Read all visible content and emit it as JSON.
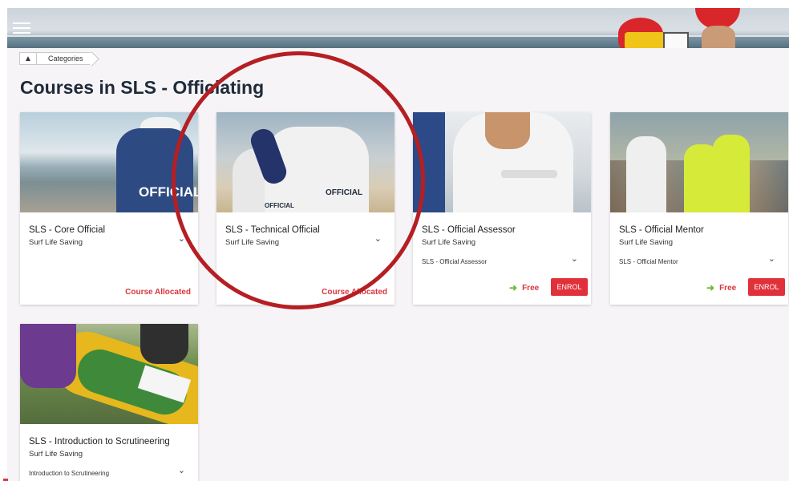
{
  "breadcrumb": {
    "home_icon": "home-icon",
    "items": [
      "Categories"
    ]
  },
  "page_title": "Courses in SLS - Officiating",
  "courses": [
    {
      "title": "SLS - Core Official",
      "org": "Surf Life Saving",
      "status": "Course Allocated"
    },
    {
      "title": "SLS - Technical Official",
      "org": "Surf Life Saving",
      "status": "Course Allocated"
    },
    {
      "title": "SLS - Official Assessor",
      "org": "Surf Life Saving",
      "subtitle": "SLS - Official Assessor",
      "price": "Free",
      "action": "ENROL"
    },
    {
      "title": "SLS - Official Mentor",
      "org": "Surf Life Saving",
      "subtitle": "SLS - Official Mentor",
      "price": "Free",
      "action": "ENROL"
    },
    {
      "title": "SLS - Introduction to Scrutineering",
      "org": "Surf Life Saving",
      "subtitle": "Introduction to Scrutineering"
    }
  ],
  "image_text": {
    "official": "OFFICIAL",
    "official_small": "OFFICIAL"
  },
  "colors": {
    "accent_red": "#e0313a",
    "free_arrow": "#6bbd3a",
    "annotation": "#b51f24"
  },
  "icons": {
    "menu": "hamburger-menu-icon",
    "expand": "chevron-down-icon",
    "price": "arrow-right-icon"
  }
}
